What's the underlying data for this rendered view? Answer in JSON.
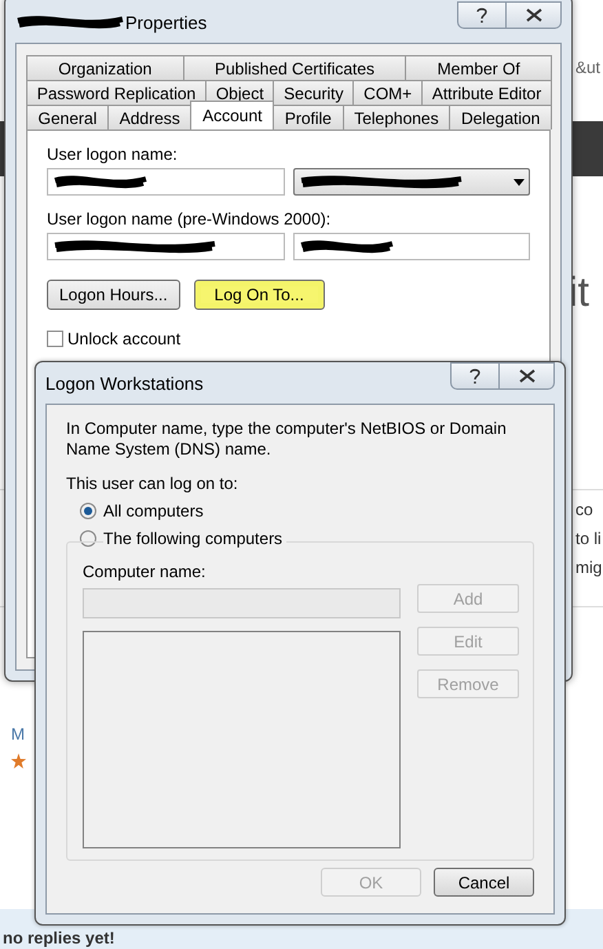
{
  "background_page": {
    "fragments": [
      {
        "text": "&ut",
        "kind": "small"
      },
      {
        "text": "it",
        "kind": "large"
      },
      {
        "text": "co",
        "kind": "body"
      },
      {
        "text": "to li",
        "kind": "body"
      },
      {
        "text": "mig",
        "kind": "body"
      },
      {
        "text": "M",
        "kind": "link"
      },
      {
        "text": "no replies yet!",
        "kind": "heading"
      }
    ]
  },
  "properties_window": {
    "title": "Properties",
    "title_redacted": true,
    "tab_rows": [
      [
        {
          "label": "Organization",
          "selected": false
        },
        {
          "label": "Published Certificates",
          "selected": false
        },
        {
          "label": "Member Of",
          "selected": false
        }
      ],
      [
        {
          "label": "Password Replication",
          "selected": false
        },
        {
          "label": "Object",
          "selected": false
        },
        {
          "label": "Security",
          "selected": false
        },
        {
          "label": "COM+",
          "selected": false
        },
        {
          "label": "Attribute Editor",
          "selected": false
        }
      ],
      [
        {
          "label": "General",
          "selected": false
        },
        {
          "label": "Address",
          "selected": false
        },
        {
          "label": "Account",
          "selected": true
        },
        {
          "label": "Profile",
          "selected": false
        },
        {
          "label": "Telephones",
          "selected": false
        },
        {
          "label": "Delegation",
          "selected": false
        }
      ]
    ],
    "user_logon_name": {
      "label": "User logon name:",
      "name_redacted": true,
      "domain_redacted": true
    },
    "pre_windows_2000": {
      "label": "User logon name (pre-Windows 2000):",
      "domain_redacted": true,
      "name_redacted": true
    },
    "buttons": [
      {
        "label": "Logon Hours...",
        "highlighted": false
      },
      {
        "label": "Log On To...",
        "highlighted": true
      }
    ],
    "unlock_account": {
      "label": "Unlock account",
      "checked": false
    }
  },
  "logon_workstations": {
    "title": "Logon Workstations",
    "instructions": "In Computer name, type the computer's NetBIOS or Domain Name System (DNS) name.",
    "prompt": "This user can log on to:",
    "options": [
      {
        "label": "All computers",
        "selected": true
      },
      {
        "label": "The following computers",
        "selected": false
      }
    ],
    "computer_name": {
      "label": "Computer name:",
      "disabled": true
    },
    "side_buttons": [
      {
        "label": "Add",
        "disabled": true
      },
      {
        "label": "Edit",
        "disabled": true
      },
      {
        "label": "Remove",
        "disabled": true
      }
    ],
    "footer_buttons": [
      {
        "label": "OK",
        "disabled": true
      },
      {
        "label": "Cancel",
        "disabled": false
      }
    ]
  }
}
